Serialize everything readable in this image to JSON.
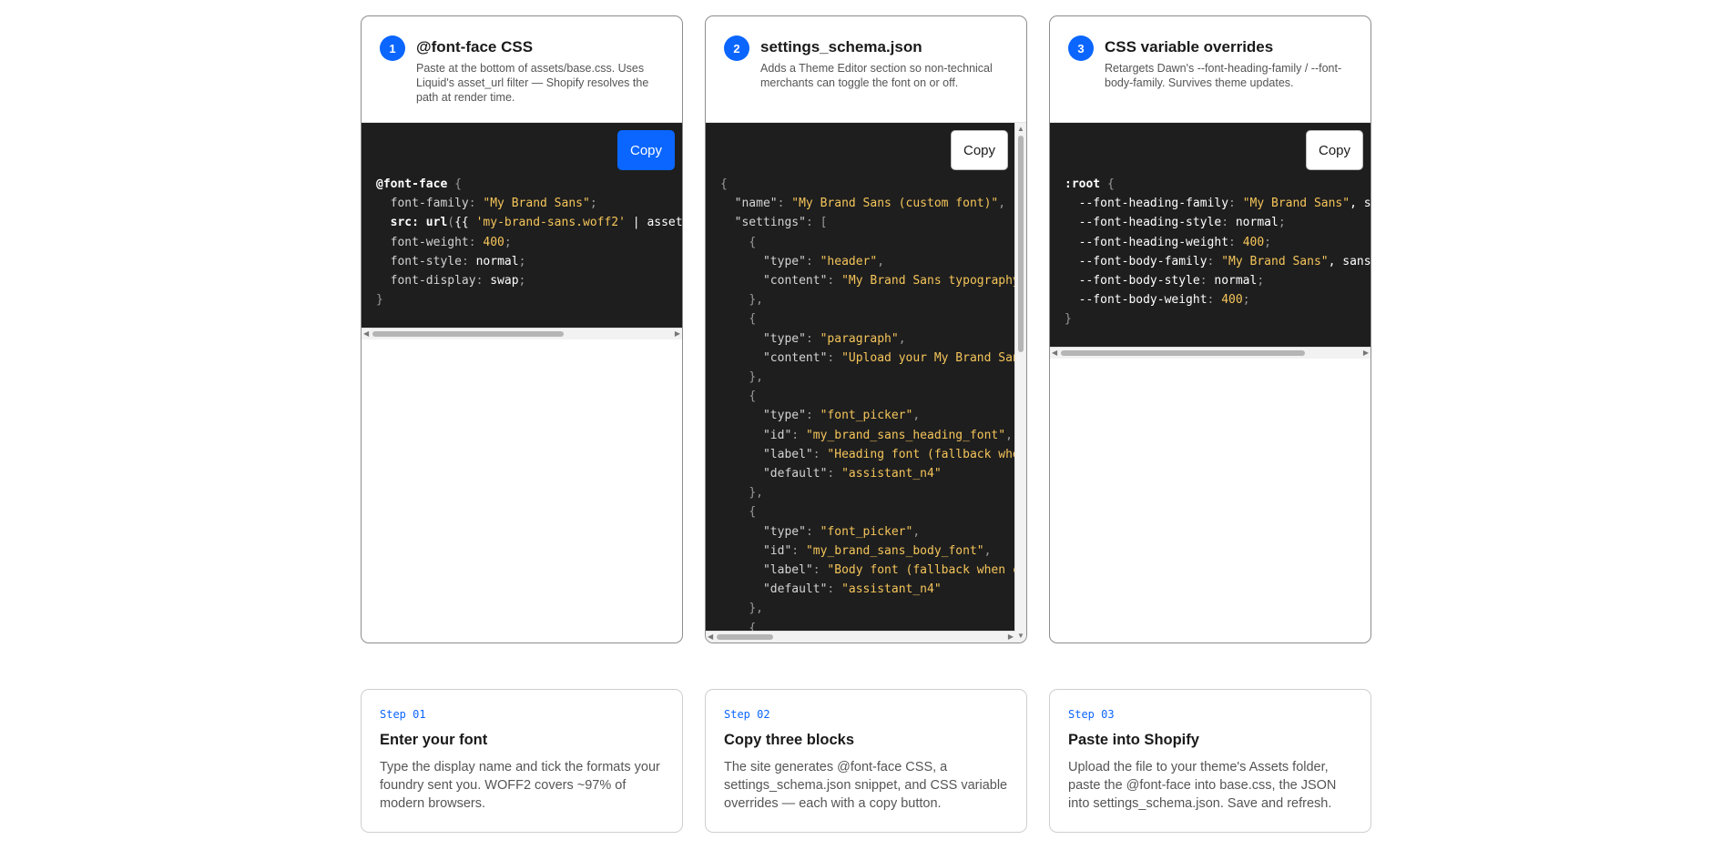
{
  "cards": [
    {
      "number": "1",
      "title": "@font-face CSS",
      "description": "Paste at the bottom of assets/base.css. Uses Liquid's asset_url filter — Shopify resolves the path at render time.",
      "copy_label": "Copy"
    },
    {
      "number": "2",
      "title": "settings_schema.json",
      "description": "Adds a Theme Editor section so non-technical merchants can toggle the font on or off.",
      "copy_label": "Copy"
    },
    {
      "number": "3",
      "title": "CSS variable overrides",
      "description": "Retargets Dawn's --font-heading-family / --font-body-family. Survives theme updates.",
      "copy_label": "Copy"
    }
  ],
  "code": {
    "css": {
      "selector": "@font-face",
      "family_prop": "font-family",
      "family_val": "\"My Brand Sans\"",
      "src_prop": "src: url",
      "src_val": "'my-brand-sans.woff2'",
      "src_tail": " | asset",
      "weight_prop": "font-weight",
      "weight_val": "400",
      "style_prop": "font-style",
      "style_val": "normal",
      "display_prop": "font-display",
      "display_val": "swap"
    },
    "json": {
      "name_key": "\"name\"",
      "name_val": "\"My Brand Sans (custom font)\"",
      "settings_key": "\"settings\"",
      "type_key": "\"type\"",
      "content_key": "\"content\"",
      "id_key": "\"id\"",
      "label_key": "\"label\"",
      "default_key": "\"default\"",
      "header_val": "\"header\"",
      "header_content": "\"My Brand Sans typography",
      "paragraph_val": "\"paragraph\"",
      "paragraph_content": "\"Upload your My Brand San",
      "font_picker_val": "\"font_picker\"",
      "heading_id": "\"my_brand_sans_heading_font\"",
      "heading_label": "\"Heading font (fallback whe",
      "default_val": "\"assistant_n4\"",
      "body_id": "\"my_brand_sans_body_font\"",
      "body_label": "\"Body font (fallback when c"
    },
    "vars": {
      "selector": ":root",
      "hf_prop": "--font-heading-family",
      "hf_val": "\"My Brand Sans\"",
      "hf_tail": ", s",
      "hs_prop": "--font-heading-style",
      "hs_val": "normal",
      "hw_prop": "--font-heading-weight",
      "hw_val": "400",
      "bf_prop": "--font-body-family",
      "bf_val": "\"My Brand Sans\"",
      "bf_tail": ", sans",
      "bs_prop": "--font-body-style",
      "bs_val": "normal",
      "bw_prop": "--font-body-weight",
      "bw_val": "400"
    }
  },
  "steps": [
    {
      "tag": "Step 01",
      "title": "Enter your font",
      "text": "Type the display name and tick the formats your foundry sent you. WOFF2 covers ~97% of modern browsers."
    },
    {
      "tag": "Step 02",
      "title": "Copy three blocks",
      "text": "The site generates @font-face CSS, a settings_schema.json snippet, and CSS variable overrides — each with a copy button."
    },
    {
      "tag": "Step 03",
      "title": "Paste into Shopify",
      "text": "Upload the file to your theme's Assets folder, paste the @font-face into base.css, the JSON into settings_schema.json. Save and refresh."
    }
  ]
}
